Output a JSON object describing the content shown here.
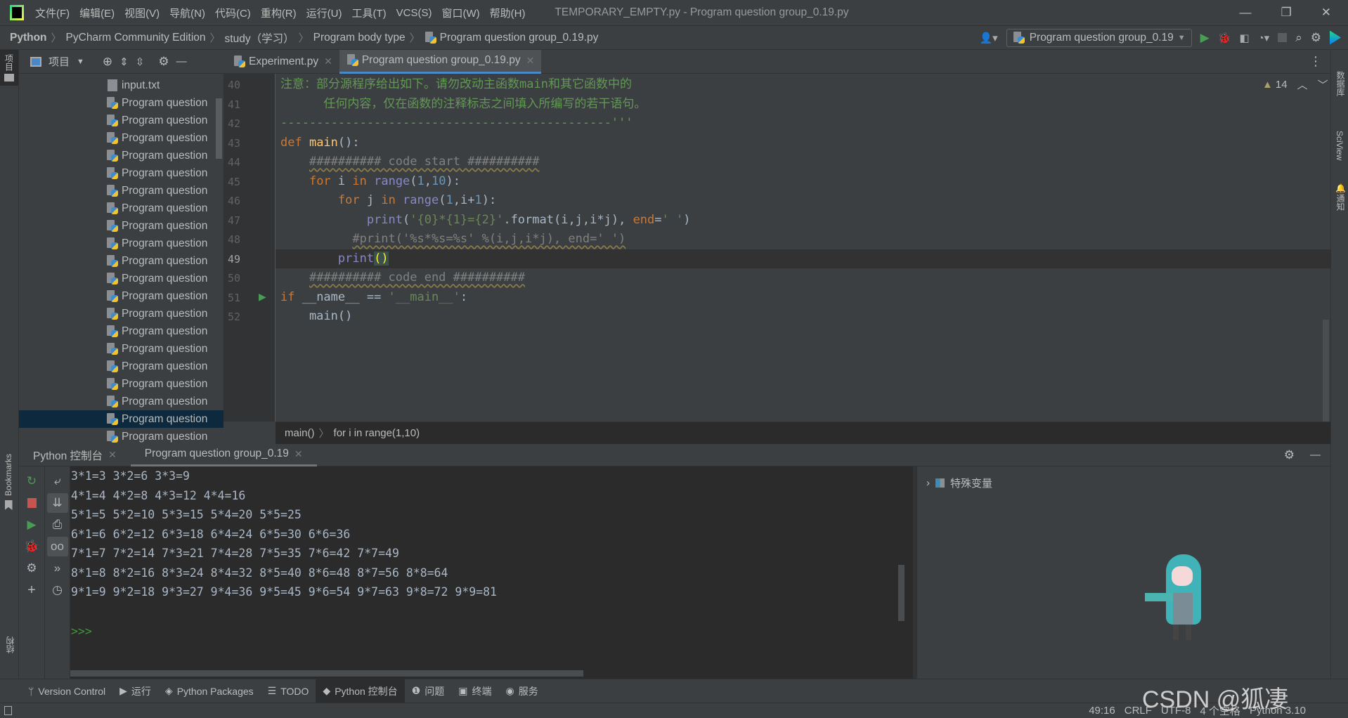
{
  "window": {
    "title": "TEMPORARY_EMPTY.py - Program question group_0.19.py",
    "menu": [
      "文件(F)",
      "编辑(E)",
      "视图(V)",
      "导航(N)",
      "代码(C)",
      "重构(R)",
      "运行(U)",
      "工具(T)",
      "VCS(S)",
      "窗口(W)",
      "帮助(H)"
    ]
  },
  "breadcrumb": [
    "Python",
    "PyCharm Community Edition",
    "study（学习）",
    "Program body type",
    "Program question group_0.19.py"
  ],
  "run_config": "Program question group_0.19",
  "left_stripe": {
    "project": "项目",
    "bookmarks": "Bookmarks",
    "structure": "结构"
  },
  "right_stripe": [
    "数据库",
    "SciView",
    "通知"
  ],
  "project_panel": {
    "title": "项目",
    "items": [
      "input.txt",
      "Program question",
      "Program question",
      "Program question",
      "Program question",
      "Program question",
      "Program question",
      "Program question",
      "Program question",
      "Program question",
      "Program question",
      "Program question",
      "Program question",
      "Program question",
      "Program question",
      "Program question",
      "Program question",
      "Program question",
      "Program question",
      "Program question",
      "Program question"
    ],
    "selected_index": 19
  },
  "editor": {
    "tabs": [
      {
        "label": "Experiment.py",
        "active": false
      },
      {
        "label": "Program question group_0.19.py",
        "active": true
      }
    ],
    "warnings": "14",
    "current_line": 49,
    "lines": [
      {
        "n": "40",
        "tokens": [
          [
            "注意：部分源程序给出如下。请勿改动主函数main和其它函数中的",
            "doc"
          ]
        ]
      },
      {
        "n": "41",
        "tokens": [
          [
            "      任何内容，仅在函数的注释标志之间填入所编写的若干语句。",
            "doc"
          ]
        ]
      },
      {
        "n": "42",
        "tokens": [
          [
            "----------------------------------------------'''",
            "doc"
          ]
        ]
      },
      {
        "n": "43",
        "tokens": [
          [
            "def ",
            "kw"
          ],
          [
            "main",
            "fn"
          ],
          [
            "():",
            ""
          ]
        ]
      },
      {
        "n": "44",
        "tokens": [
          [
            "    ",
            ""
          ],
          [
            "########## code start ##########",
            "cm"
          ]
        ]
      },
      {
        "n": "45",
        "tokens": [
          [
            "    ",
            ""
          ],
          [
            "for ",
            "kw"
          ],
          [
            "i ",
            ""
          ],
          [
            "in ",
            "kw"
          ],
          [
            "range",
            "bi"
          ],
          [
            "(",
            ""
          ],
          [
            "1",
            "num"
          ],
          [
            ",",
            ""
          ],
          [
            "10",
            "num"
          ],
          [
            "):",
            ""
          ]
        ]
      },
      {
        "n": "46",
        "tokens": [
          [
            "        ",
            ""
          ],
          [
            "for ",
            "kw"
          ],
          [
            "j ",
            ""
          ],
          [
            "in ",
            "kw"
          ],
          [
            "range",
            "bi"
          ],
          [
            "(",
            ""
          ],
          [
            "1",
            "num"
          ],
          [
            ",i+",
            ""
          ],
          [
            "1",
            "num"
          ],
          [
            "):",
            ""
          ]
        ]
      },
      {
        "n": "47",
        "tokens": [
          [
            "            ",
            ""
          ],
          [
            "print",
            "bi"
          ],
          [
            "(",
            ""
          ],
          [
            "'{0}*{1}={2}'",
            "str"
          ],
          [
            ".format(i,j,i*j), ",
            ""
          ],
          [
            "end",
            "kw"
          ],
          [
            "=",
            ""
          ],
          [
            "' '",
            "str"
          ],
          [
            ")",
            ""
          ]
        ]
      },
      {
        "n": "48",
        "tokens": [
          [
            "          ",
            ""
          ],
          [
            "#print('%s*%s=%s' %(i,j,i*j), end=' ')",
            "cm"
          ]
        ]
      },
      {
        "n": "49",
        "tokens": [
          [
            "        ",
            ""
          ],
          [
            "print",
            "bi"
          ],
          [
            "()",
            "br"
          ]
        ]
      },
      {
        "n": "50",
        "tokens": [
          [
            "    ",
            ""
          ],
          [
            "########## code end ##########",
            "cm"
          ]
        ]
      },
      {
        "n": "51",
        "tokens": [
          [
            "if ",
            "kw"
          ],
          [
            "__name__ == ",
            ""
          ],
          [
            "'__main__'",
            "str"
          ],
          [
            ":",
            ""
          ]
        ]
      },
      {
        "n": "52",
        "tokens": [
          [
            "    main()",
            ""
          ]
        ]
      }
    ],
    "breadcrumb": [
      "main()",
      "for i in range(1,10)"
    ]
  },
  "bottom_panel": {
    "tabs": [
      {
        "label": "Python 控制台",
        "active": false
      },
      {
        "label": "Program question group_0.19",
        "active": true
      }
    ],
    "console_lines": [
      "3*1=3 3*2=6 3*3=9",
      "4*1=4 4*2=8 4*3=12 4*4=16",
      "5*1=5 5*2=10 5*3=15 5*4=20 5*5=25",
      "6*1=6 6*2=12 6*3=18 6*4=24 6*5=30 6*6=36",
      "7*1=7 7*2=14 7*3=21 7*4=28 7*5=35 7*6=42 7*7=49",
      "8*1=8 8*2=16 8*3=24 8*4=32 8*5=40 8*6=48 8*7=56 8*8=64",
      "9*1=9 9*2=18 9*3=27 9*4=36 9*5=45 9*6=54 9*7=63 9*8=72 9*9=81"
    ],
    "prompt": ">>>",
    "variables_label": "特殊变量"
  },
  "tool_windows": [
    {
      "label": "Version Control",
      "icon": "branch-icon"
    },
    {
      "label": "运行",
      "icon": "run-icon"
    },
    {
      "label": "Python Packages",
      "icon": "layers-icon"
    },
    {
      "label": "TODO",
      "icon": "list-icon"
    },
    {
      "label": "Python 控制台",
      "icon": "python-icon",
      "active": true
    },
    {
      "label": "问题",
      "icon": "warning-icon"
    },
    {
      "label": "终端",
      "icon": "terminal-icon"
    },
    {
      "label": "服务",
      "icon": "services-icon"
    }
  ],
  "status_bar": {
    "position": "49:16",
    "line_sep": "CRLF",
    "encoding": "UTF-8",
    "indent": "4 个空格",
    "interpreter": "Python 3.10"
  },
  "watermark": "CSDN @狐凄",
  "colors": {
    "accent": "#4a88c7",
    "keyword": "#cc7832",
    "string": "#6a8759",
    "number": "#6897bb",
    "run_green": "#499c54",
    "stop_red": "#c75450"
  }
}
